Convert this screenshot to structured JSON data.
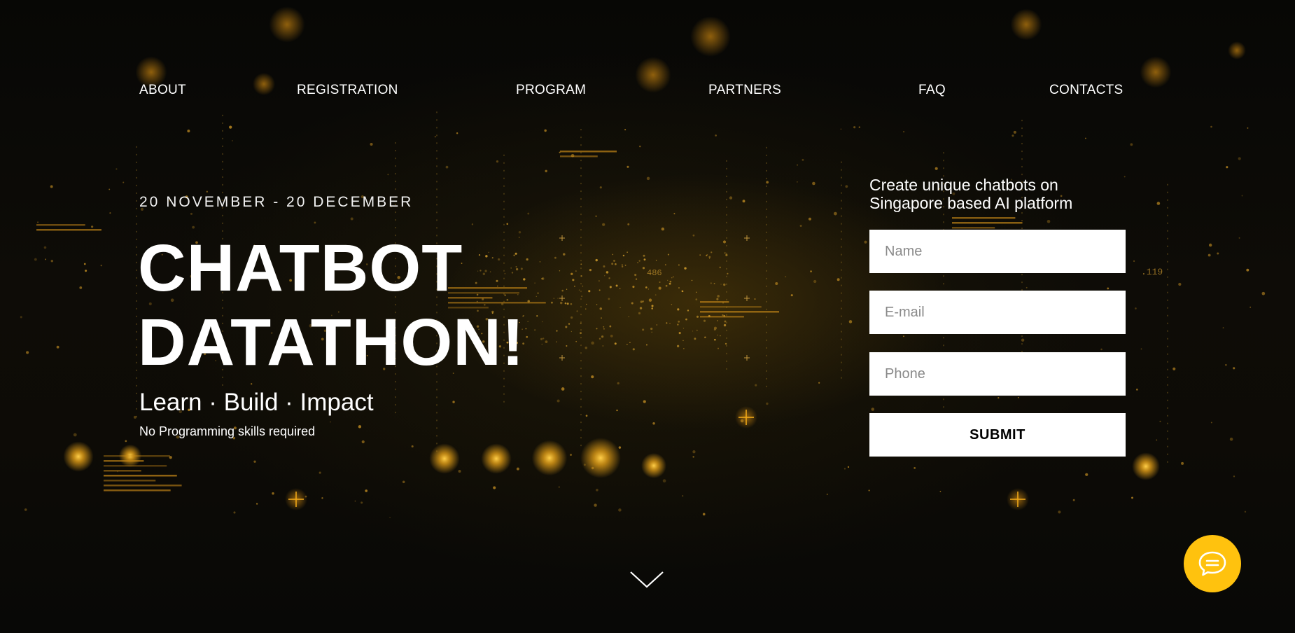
{
  "nav": {
    "items": [
      {
        "label": "ABOUT"
      },
      {
        "label": "REGISTRATION"
      },
      {
        "label": "PROGRAM"
      },
      {
        "label": "PARTNERS"
      },
      {
        "label": "FAQ"
      },
      {
        "label": "CONTACTS"
      }
    ]
  },
  "hero": {
    "date_range": "20 NOVEMBER - 20 DECEMBER",
    "title_line1": "CHATBOT",
    "title_line2": "DATATHON!",
    "tagline": "Learn · Build · Impact",
    "subnote": "No Programming skills required"
  },
  "form": {
    "intro_line1": "Create unique chatbots on",
    "intro_line2": "Singapore based AI platform",
    "name_placeholder": "Name",
    "email_placeholder": "E-mail",
    "phone_placeholder": "Phone",
    "name_value": "",
    "email_value": "",
    "phone_value": "",
    "submit_label": "SUBMIT"
  },
  "background": {
    "code_labels": [
      "486",
      ".119"
    ]
  },
  "icons": {
    "scroll": "chevron-down-icon",
    "chat": "chat-bubble-icon"
  },
  "colors": {
    "accent": "#ffc20e",
    "background": "#0b0a06",
    "text": "#ffffff",
    "glow": "#f0a818"
  }
}
